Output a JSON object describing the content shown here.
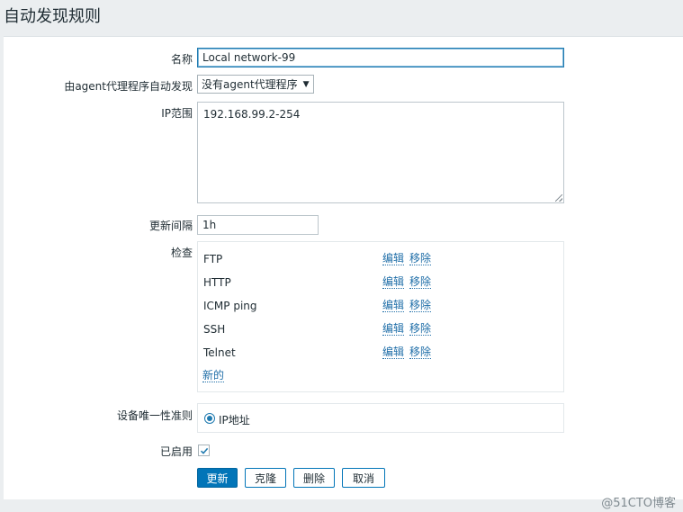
{
  "page": {
    "title": "自动发现规则"
  },
  "form": {
    "name": {
      "label": "名称",
      "value": "Local network-99"
    },
    "proxy": {
      "label": "由agent代理程序自动发现",
      "selected": "没有agent代理程序"
    },
    "ip_range": {
      "label": "IP范围",
      "value": "192.168.99.2-254"
    },
    "interval": {
      "label": "更新间隔",
      "value": "1h"
    },
    "checks": {
      "label": "检查",
      "items": [
        {
          "name": "FTP",
          "edit": "编辑",
          "remove": "移除"
        },
        {
          "name": "HTTP",
          "edit": "编辑",
          "remove": "移除"
        },
        {
          "name": "ICMP ping",
          "edit": "编辑",
          "remove": "移除"
        },
        {
          "name": "SSH",
          "edit": "编辑",
          "remove": "移除"
        },
        {
          "name": "Telnet",
          "edit": "编辑",
          "remove": "移除"
        }
      ],
      "new_label": "新的"
    },
    "uniqueness": {
      "label": "设备唯一性准则",
      "option": "IP地址"
    },
    "enabled": {
      "label": "已启用",
      "checked": true
    }
  },
  "buttons": {
    "update": "更新",
    "clone": "克隆",
    "delete": "删除",
    "cancel": "取消"
  },
  "watermark": "@51CTO博客",
  "colors": {
    "accent": "#0275b8",
    "link": "#1f6ea8",
    "background": "#ebeef0"
  }
}
